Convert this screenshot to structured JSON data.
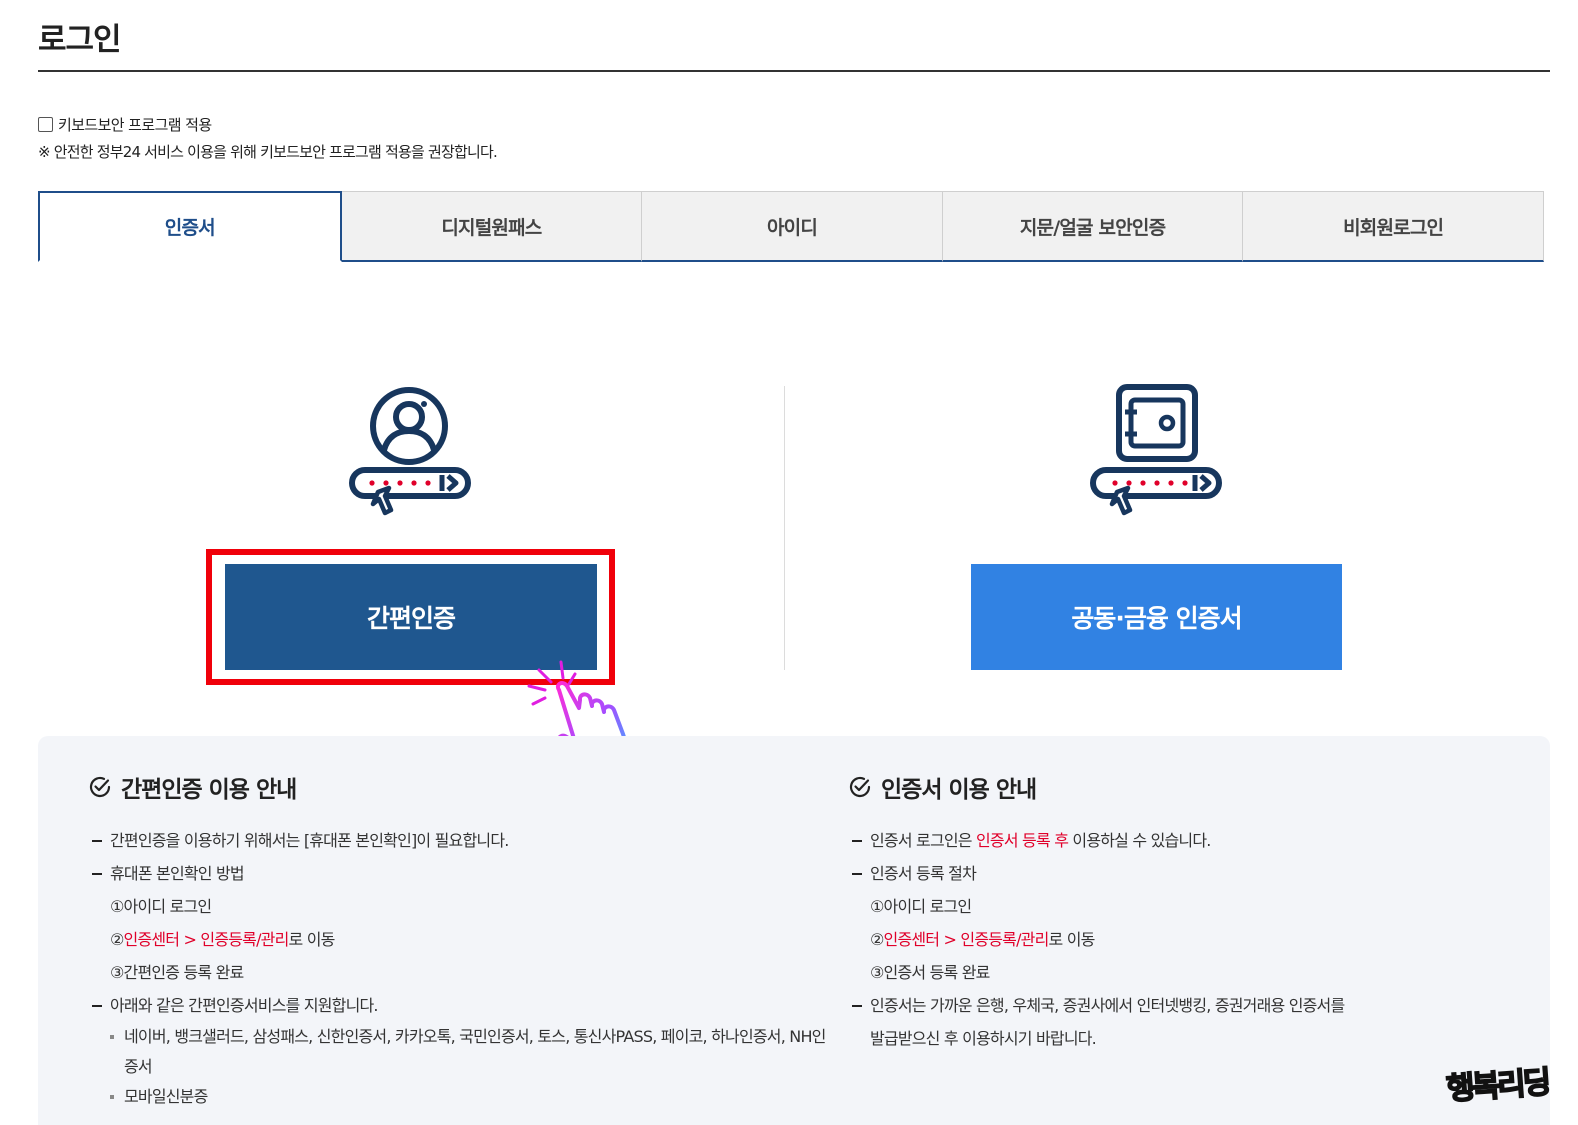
{
  "page": {
    "title": "로그인"
  },
  "keyboard_security": {
    "checkbox_label": "키보드보안 프로그램 적용",
    "checked": false,
    "notice": "※ 안전한 정부24 서비스 이용을 위해 키보드보안 프로그램 적용을 권장합니다."
  },
  "tabs": [
    {
      "label": "인증서",
      "active": true
    },
    {
      "label": "디지털원패스",
      "active": false
    },
    {
      "label": "아이디",
      "active": false
    },
    {
      "label": "지문/얼굴 보안인증",
      "active": false
    },
    {
      "label": "비회원로그인",
      "active": false
    }
  ],
  "login_options": {
    "simple": {
      "icon": "user-password-icon",
      "button_label": "간편인증",
      "highlighted": true
    },
    "certificate": {
      "icon": "safe-password-icon",
      "button_label": "공동·금융 인증서"
    }
  },
  "guide": {
    "simple": {
      "title": "간편인증 이용 안내",
      "item1": "간편인증을 이용하기 위해서는 [휴대폰 본인확인]이 필요합니다.",
      "item2": "휴대폰 본인확인 방법",
      "step1": "①아이디 로그인",
      "step2_prefix": "②",
      "step2_link": "인증센터 > 인증등록/관리",
      "step2_suffix": "로 이동",
      "step3": "③간편인증 등록 완료",
      "item3": "아래와 같은 간편인증서비스를 지원합니다.",
      "bullet1": "네이버, 뱅크샐러드, 삼성패스, 신한인증서, 카카오톡, 국민인증서, 토스, 통신사PASS, 페이코, 하나인증서, NH인",
      "bullet1_cont": "증서",
      "bullet2": "모바일신분증"
    },
    "certificate": {
      "title": "인증서 이용 안내",
      "item1_prefix": "인증서 로그인은 ",
      "item1_highlight": "인증서 등록 후",
      "item1_suffix": " 이용하실 수 있습니다.",
      "item2": "인증서 등록 절차",
      "step1": "①아이디 로그인",
      "step2_prefix": "②",
      "step2_link": "인증센터 > 인증등록/관리",
      "step2_suffix": "로 이동",
      "step3": "③인증서 등록 완료",
      "item3": "인증서는 가까운 은행, 우체국, 증권사에서 인터넷뱅킹, 증권거래용 인증서를",
      "item3_cont": "발급받으신 후 이용하시기 바랍니다."
    }
  },
  "watermark": "행복리딩",
  "colors": {
    "primary_dark": "#1f578f",
    "primary_light": "#3182e3",
    "highlight_red": "#f0000a",
    "link_red": "#e0002a",
    "panel_bg": "#f3f5f9"
  }
}
